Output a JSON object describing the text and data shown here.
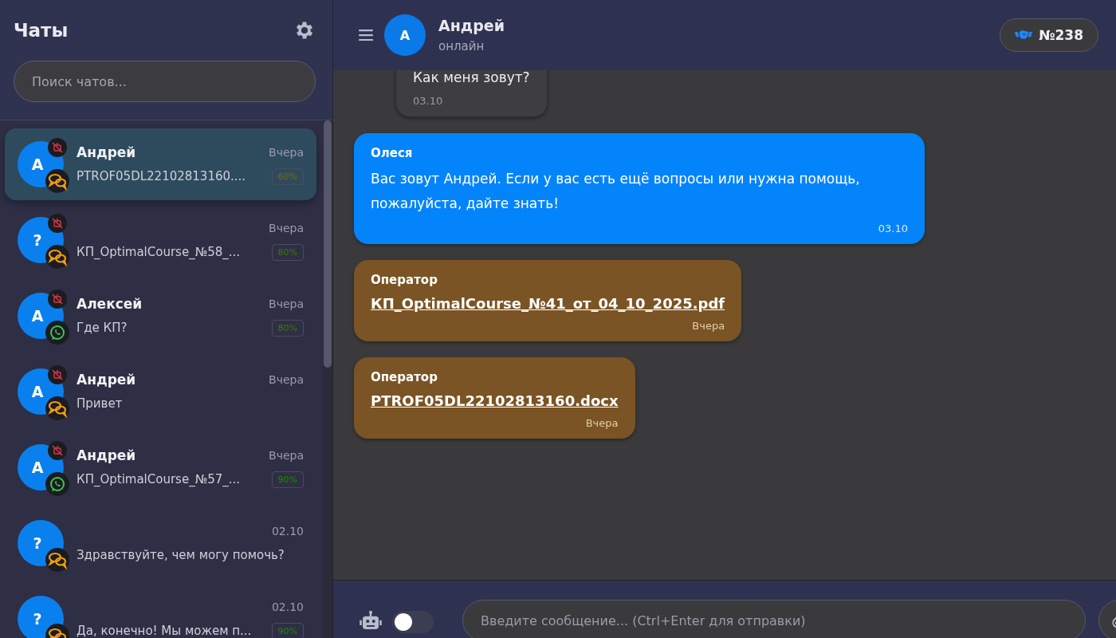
{
  "sidebar": {
    "title": "Чаты",
    "search": {
      "placeholder": "Поиск чатов..."
    },
    "chats": [
      {
        "avatar": "А",
        "name": "Андрей",
        "time": "Вчера",
        "preview": "PTROF05DL22102813160....",
        "score": "60%",
        "color": "#7a6a00",
        "kind": "chat",
        "bot_off": true,
        "selected": true
      },
      {
        "avatar": "?",
        "time": "Вчера",
        "preview": "КП_OptimalCourse_№58_...",
        "score": "80%",
        "color": "#3d7a00",
        "kind": "chat",
        "bot_off": true,
        "selected": false
      },
      {
        "avatar": "А",
        "name": "Алексей",
        "time": "Вчера",
        "preview": "Где КП?",
        "score": "80%",
        "color": "#3d7a00",
        "kind": "whatsapp",
        "bot_off": true,
        "selected": false
      },
      {
        "avatar": "А",
        "name": "Андрей",
        "time": "Вчера",
        "preview": "Привет",
        "kind": "chat",
        "bot_off": true,
        "selected": false
      },
      {
        "avatar": "А",
        "name": "Андрей",
        "time": "Вчера",
        "preview": "КП_OptimalCourse_№57_...",
        "score": "90%",
        "color": "#1f8a00",
        "kind": "whatsapp",
        "bot_off": true,
        "selected": false
      },
      {
        "avatar": "?",
        "time": "02.10",
        "preview": "Здравствуйте, чем могу помочь?",
        "kind": "chat",
        "bot_off": false,
        "selected": false
      },
      {
        "avatar": "?",
        "time": "02.10",
        "preview": "Да, конечно! Мы можем п...",
        "score": "90%",
        "color": "#1f8a00",
        "kind": "chat",
        "bot_off": false,
        "selected": false
      }
    ]
  },
  "header": {
    "avatar": "А",
    "name": "Андрей",
    "status": "онлайн",
    "deal": "№238"
  },
  "messages": [
    {
      "kind": "client",
      "text": "Как меня зовут?",
      "time": "03.10"
    },
    {
      "kind": "bot",
      "author": "Олеся",
      "text": "Вас зовут Андрей. Если у вас есть ещё вопросы или нужна помощь, пожалуйста, дайте знать!",
      "time": "03.10"
    },
    {
      "kind": "operator",
      "author": "Оператор",
      "file": "КП_OptimalCourse_№41_от_04_10_2025.pdf",
      "time": "Вчера"
    },
    {
      "kind": "operator",
      "author": "Оператор",
      "file": "PTROF05DL22102813160.docx",
      "time": "Вчера"
    }
  ],
  "composer": {
    "bot_on": false,
    "placeholder": "Введите сообщение... (Ctrl+Enter для отправки)"
  }
}
